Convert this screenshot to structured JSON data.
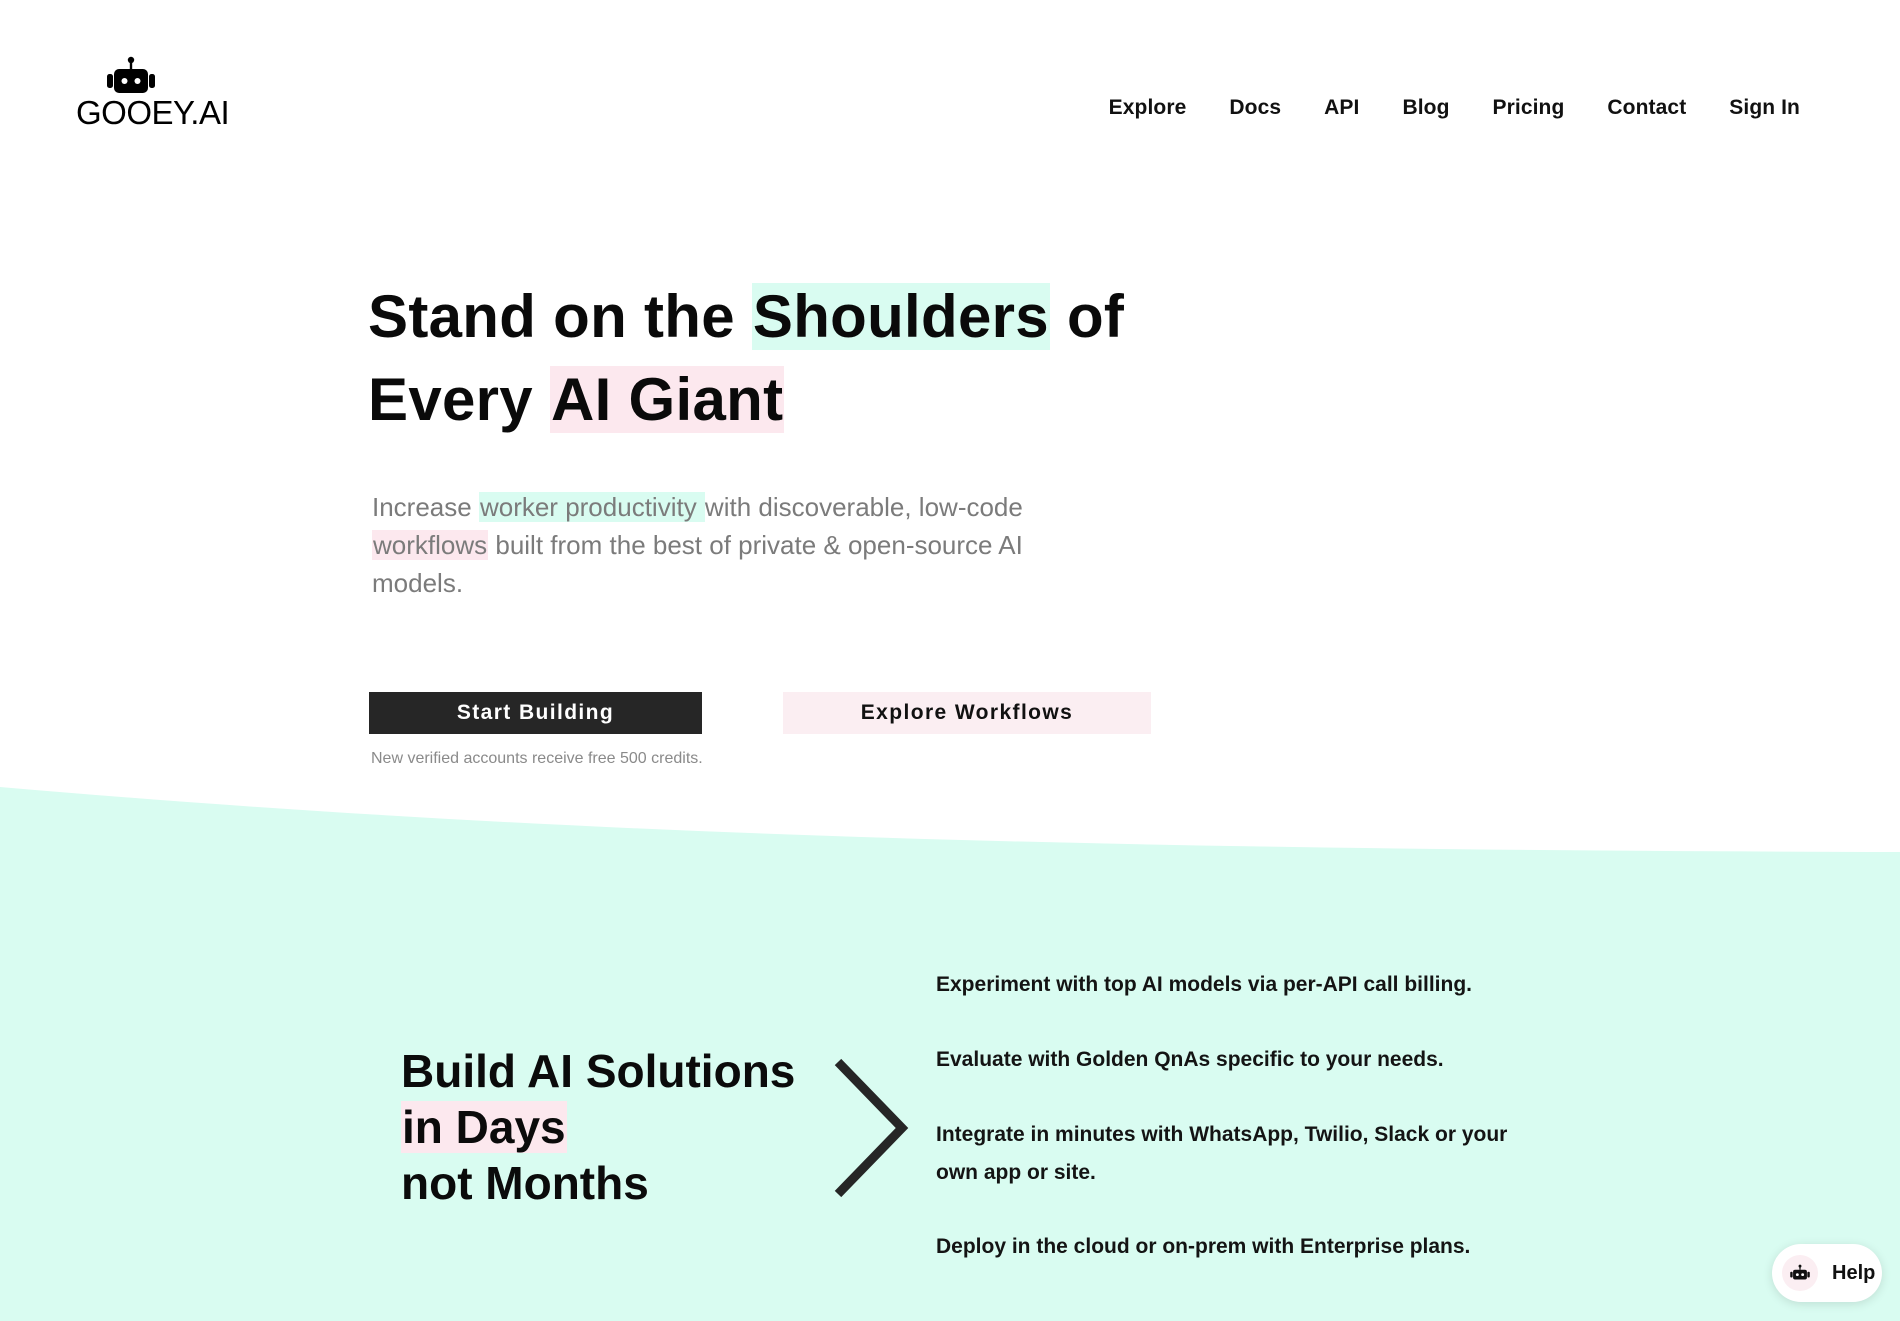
{
  "brand": {
    "name": "GOOEY.AI",
    "logo_icon": "robot-icon"
  },
  "nav": {
    "items": [
      {
        "label": "Explore"
      },
      {
        "label": "Docs"
      },
      {
        "label": "API"
      },
      {
        "label": "Blog"
      },
      {
        "label": "Pricing"
      },
      {
        "label": "Contact"
      },
      {
        "label": "Sign In"
      }
    ]
  },
  "hero": {
    "title": {
      "line1_prefix": "Stand on the ",
      "line1_highlight": "Shoulders",
      "line1_suffix": " of",
      "line2_prefix": "Every ",
      "line2_highlight": "AI Giant"
    },
    "subtitle": {
      "prefix": "Increase ",
      "highlight1": "worker productivity ",
      "middle": "with discoverable, low-code ",
      "highlight2": "workflows",
      "suffix": " built from the best of private & open-source AI models."
    },
    "primary_button": "Start Building",
    "secondary_button": "Explore Workflows",
    "credits_note": "New verified accounts receive free 500 credits."
  },
  "solutions": {
    "title_line1": "Build AI Solutions",
    "title_line2": "in Days",
    "title_line3": "not Months",
    "arrow_icon": "chevron-right-icon",
    "features": [
      "Experiment with top AI models via per-API call billing.",
      "Evaluate with Golden QnAs specific to your needs.",
      "Integrate in minutes with WhatsApp, Twilio, Slack or your own app or site.",
      "Deploy in the cloud or on-prem with Enterprise plans."
    ]
  },
  "help_widget": {
    "label": "Help",
    "icon": "robot-icon"
  },
  "colors": {
    "mint": "#d9fcf1",
    "pink": "#fce8ee",
    "primary_button": "#262626",
    "text": "#0c0c0c",
    "muted_text": "#7b7b7b"
  }
}
